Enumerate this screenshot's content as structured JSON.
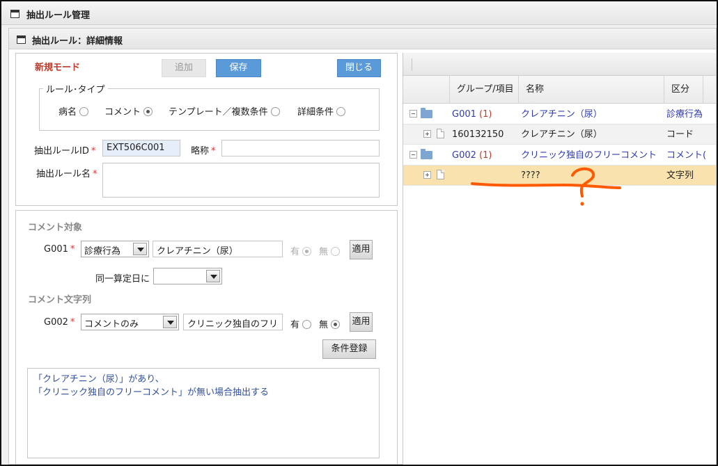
{
  "window": {
    "title": "抽出ルール管理"
  },
  "panel": {
    "title": "抽出ルール：詳細情報"
  },
  "form": {
    "mode": "新規モード",
    "add_label": "追加",
    "save_label": "保存",
    "close_label": "閉じる",
    "rule_type": {
      "legend": "ルール･タイプ",
      "options": [
        {
          "label": "病名",
          "selected": false
        },
        {
          "label": "コメント",
          "selected": true
        },
        {
          "label": "テンプレート／複数条件",
          "selected": false
        },
        {
          "label": "詳細条件",
          "selected": false
        }
      ]
    },
    "rule_id": {
      "label": "抽出ルールID",
      "required": "*",
      "value": "EXT506C001"
    },
    "short_name": {
      "label": "略称",
      "required": "*",
      "value": ""
    },
    "rule_name": {
      "label": "抽出ルール名",
      "required": "*",
      "value": ""
    }
  },
  "comment_target": {
    "title": "コメント対象",
    "group": "G001",
    "required": "*",
    "category": "診療行為",
    "item": "クレアチニン（尿）",
    "exists_label": "有",
    "none_label": "無",
    "apply_label": "適用",
    "same_day": {
      "label": "同一算定日に",
      "value": ""
    }
  },
  "comment_string": {
    "title": "コメント文字列",
    "group": "G002",
    "required": "*",
    "category": "コメントのみ",
    "item": "クリニック独自のフリ",
    "exists_label": "有",
    "none_label": "無",
    "apply_label": "適用",
    "register_label": "条件登録"
  },
  "summary": {
    "lines": [
      "「クレアチニン（尿）」があり、",
      "「クリニック独自のフリーコメント」が無い場合抽出する"
    ]
  },
  "grid": {
    "columns": [
      "グループ/項目",
      "名称",
      "区分"
    ],
    "rows": [
      {
        "kind": "group",
        "group": "G001",
        "count": "(1)",
        "name": "クレアチニン（尿）",
        "category": "診療行為"
      },
      {
        "kind": "item",
        "group": "160132150",
        "count": "",
        "name": "クレアチニン（尿）",
        "category": "コード"
      },
      {
        "kind": "group",
        "group": "G002",
        "count": "(1)",
        "name": "クリニック独自のフリーコメント",
        "category": "コメント("
      },
      {
        "kind": "item",
        "group": "",
        "count": "",
        "name": "????",
        "category": "文字列"
      }
    ]
  },
  "colors": {
    "primary": "#5b9ad8",
    "accent_red": "#c0392b",
    "link": "#2e3bb0",
    "selected_row": "#f9e2ad",
    "annotation": "#ff5a00"
  },
  "icons": [
    "window-icon",
    "folder-icon",
    "document-icon",
    "expand-icon",
    "collapse-icon",
    "dropdown-arrow-icon"
  ]
}
